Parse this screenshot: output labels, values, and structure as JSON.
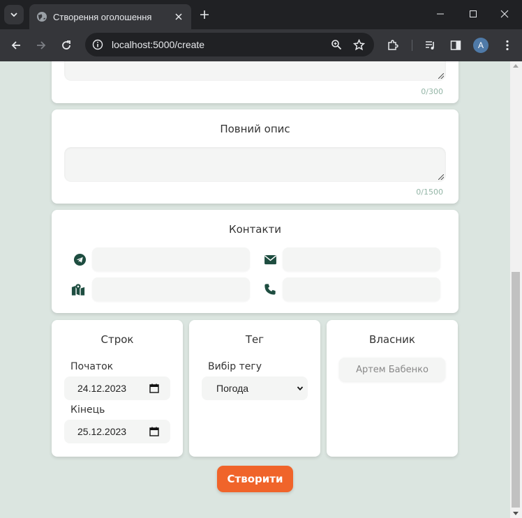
{
  "browser": {
    "tab_title": "Створення оголошення",
    "url": "localhost:5000/create",
    "profile_initial": "A"
  },
  "form": {
    "short_description": {
      "counter": "0/300"
    },
    "full_description": {
      "title": "Повний опис",
      "counter": "0/1500"
    },
    "contacts": {
      "title": "Контакти",
      "telegram_value": "",
      "email_value": "",
      "location_value": "",
      "phone_value": ""
    },
    "term": {
      "title": "Строк",
      "start_label": "Початок",
      "start_value": "24.12.2023",
      "end_label": "Кінець",
      "end_value": "25.12.2023"
    },
    "tag": {
      "title": "Тег",
      "select_label": "Вибір тегу",
      "selected": "Погода"
    },
    "owner": {
      "title": "Власник",
      "name": "Артем Бабенко"
    },
    "submit_label": "Створити"
  },
  "colors": {
    "page_bg": "#dbe5e0",
    "accent_orange": "#f0642a",
    "icon_green": "#1e4d40",
    "counter_green": "#93b5a6"
  }
}
